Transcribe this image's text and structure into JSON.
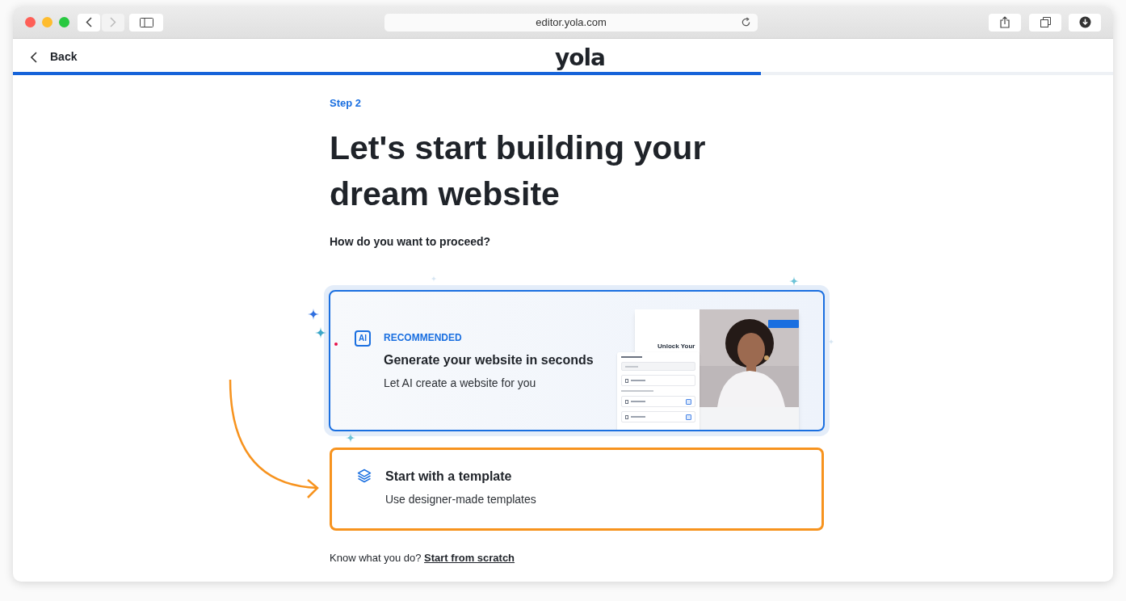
{
  "browser": {
    "url": "editor.yola.com"
  },
  "header": {
    "back": "Back",
    "logo": "yola",
    "progress": {
      "level": 0.68
    }
  },
  "step": "Step 2",
  "title": "Let's start building your dream website",
  "prompt": "How do you want to proceed?",
  "options": [
    {
      "kind": "ai",
      "badge": "AI",
      "tag": "RECOMMENDED",
      "title": "Generate your website in seconds",
      "subtitle": "Let AI create a website for you",
      "selected": false,
      "preview": {
        "headline": "Unlock Your"
      }
    },
    {
      "kind": "template",
      "title": "Start with a template",
      "subtitle": "Use designer-made templates",
      "selected": true
    }
  ],
  "footer": {
    "text": "Know what you do?",
    "link": "Start from scratch"
  }
}
